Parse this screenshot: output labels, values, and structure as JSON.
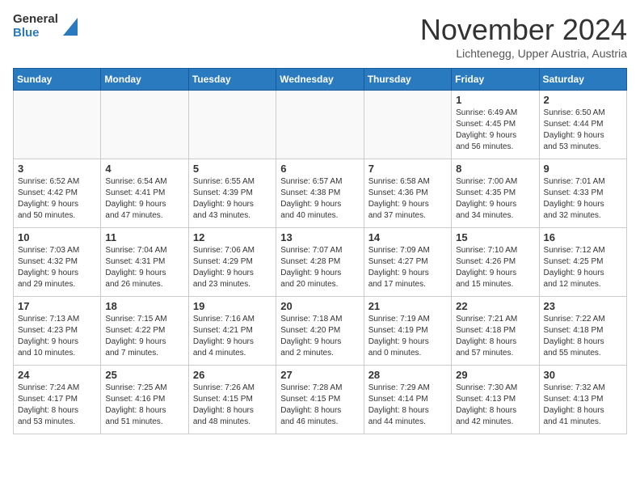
{
  "header": {
    "logo_line1": "General",
    "logo_line2": "Blue",
    "month": "November 2024",
    "location": "Lichtenegg, Upper Austria, Austria"
  },
  "weekdays": [
    "Sunday",
    "Monday",
    "Tuesday",
    "Wednesday",
    "Thursday",
    "Friday",
    "Saturday"
  ],
  "weeks": [
    [
      {
        "day": "",
        "info": ""
      },
      {
        "day": "",
        "info": ""
      },
      {
        "day": "",
        "info": ""
      },
      {
        "day": "",
        "info": ""
      },
      {
        "day": "",
        "info": ""
      },
      {
        "day": "1",
        "info": "Sunrise: 6:49 AM\nSunset: 4:45 PM\nDaylight: 9 hours\nand 56 minutes."
      },
      {
        "day": "2",
        "info": "Sunrise: 6:50 AM\nSunset: 4:44 PM\nDaylight: 9 hours\nand 53 minutes."
      }
    ],
    [
      {
        "day": "3",
        "info": "Sunrise: 6:52 AM\nSunset: 4:42 PM\nDaylight: 9 hours\nand 50 minutes."
      },
      {
        "day": "4",
        "info": "Sunrise: 6:54 AM\nSunset: 4:41 PM\nDaylight: 9 hours\nand 47 minutes."
      },
      {
        "day": "5",
        "info": "Sunrise: 6:55 AM\nSunset: 4:39 PM\nDaylight: 9 hours\nand 43 minutes."
      },
      {
        "day": "6",
        "info": "Sunrise: 6:57 AM\nSunset: 4:38 PM\nDaylight: 9 hours\nand 40 minutes."
      },
      {
        "day": "7",
        "info": "Sunrise: 6:58 AM\nSunset: 4:36 PM\nDaylight: 9 hours\nand 37 minutes."
      },
      {
        "day": "8",
        "info": "Sunrise: 7:00 AM\nSunset: 4:35 PM\nDaylight: 9 hours\nand 34 minutes."
      },
      {
        "day": "9",
        "info": "Sunrise: 7:01 AM\nSunset: 4:33 PM\nDaylight: 9 hours\nand 32 minutes."
      }
    ],
    [
      {
        "day": "10",
        "info": "Sunrise: 7:03 AM\nSunset: 4:32 PM\nDaylight: 9 hours\nand 29 minutes."
      },
      {
        "day": "11",
        "info": "Sunrise: 7:04 AM\nSunset: 4:31 PM\nDaylight: 9 hours\nand 26 minutes."
      },
      {
        "day": "12",
        "info": "Sunrise: 7:06 AM\nSunset: 4:29 PM\nDaylight: 9 hours\nand 23 minutes."
      },
      {
        "day": "13",
        "info": "Sunrise: 7:07 AM\nSunset: 4:28 PM\nDaylight: 9 hours\nand 20 minutes."
      },
      {
        "day": "14",
        "info": "Sunrise: 7:09 AM\nSunset: 4:27 PM\nDaylight: 9 hours\nand 17 minutes."
      },
      {
        "day": "15",
        "info": "Sunrise: 7:10 AM\nSunset: 4:26 PM\nDaylight: 9 hours\nand 15 minutes."
      },
      {
        "day": "16",
        "info": "Sunrise: 7:12 AM\nSunset: 4:25 PM\nDaylight: 9 hours\nand 12 minutes."
      }
    ],
    [
      {
        "day": "17",
        "info": "Sunrise: 7:13 AM\nSunset: 4:23 PM\nDaylight: 9 hours\nand 10 minutes."
      },
      {
        "day": "18",
        "info": "Sunrise: 7:15 AM\nSunset: 4:22 PM\nDaylight: 9 hours\nand 7 minutes."
      },
      {
        "day": "19",
        "info": "Sunrise: 7:16 AM\nSunset: 4:21 PM\nDaylight: 9 hours\nand 4 minutes."
      },
      {
        "day": "20",
        "info": "Sunrise: 7:18 AM\nSunset: 4:20 PM\nDaylight: 9 hours\nand 2 minutes."
      },
      {
        "day": "21",
        "info": "Sunrise: 7:19 AM\nSunset: 4:19 PM\nDaylight: 9 hours\nand 0 minutes."
      },
      {
        "day": "22",
        "info": "Sunrise: 7:21 AM\nSunset: 4:18 PM\nDaylight: 8 hours\nand 57 minutes."
      },
      {
        "day": "23",
        "info": "Sunrise: 7:22 AM\nSunset: 4:18 PM\nDaylight: 8 hours\nand 55 minutes."
      }
    ],
    [
      {
        "day": "24",
        "info": "Sunrise: 7:24 AM\nSunset: 4:17 PM\nDaylight: 8 hours\nand 53 minutes."
      },
      {
        "day": "25",
        "info": "Sunrise: 7:25 AM\nSunset: 4:16 PM\nDaylight: 8 hours\nand 51 minutes."
      },
      {
        "day": "26",
        "info": "Sunrise: 7:26 AM\nSunset: 4:15 PM\nDaylight: 8 hours\nand 48 minutes."
      },
      {
        "day": "27",
        "info": "Sunrise: 7:28 AM\nSunset: 4:15 PM\nDaylight: 8 hours\nand 46 minutes."
      },
      {
        "day": "28",
        "info": "Sunrise: 7:29 AM\nSunset: 4:14 PM\nDaylight: 8 hours\nand 44 minutes."
      },
      {
        "day": "29",
        "info": "Sunrise: 7:30 AM\nSunset: 4:13 PM\nDaylight: 8 hours\nand 42 minutes."
      },
      {
        "day": "30",
        "info": "Sunrise: 7:32 AM\nSunset: 4:13 PM\nDaylight: 8 hours\nand 41 minutes."
      }
    ]
  ]
}
